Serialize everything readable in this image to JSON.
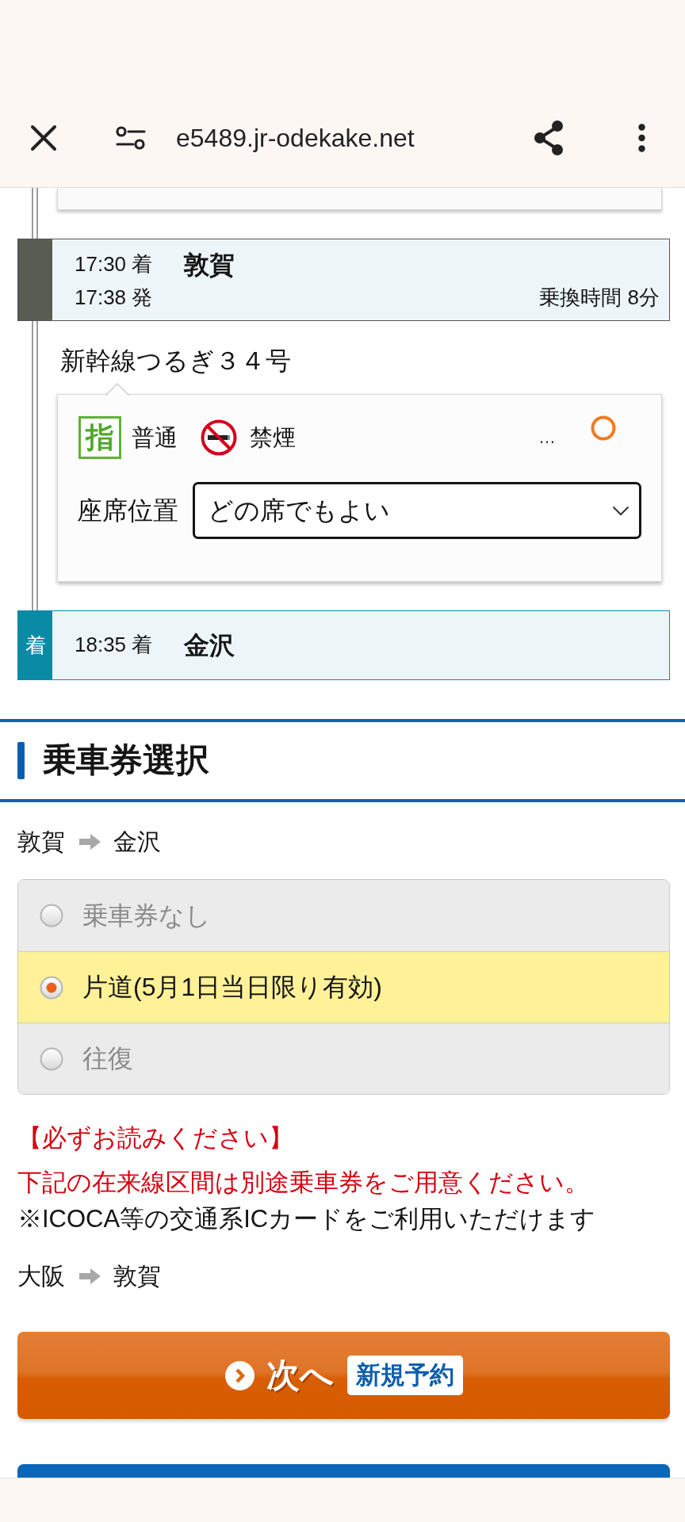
{
  "browser": {
    "url": "e5489.jr-odekake.net"
  },
  "itinerary": [
    {
      "kind": "transfer",
      "arrival": "17:30 着",
      "station": "敦賀",
      "departure": "17:38 発",
      "transfer": "乗換時間 8分"
    },
    {
      "kind": "train",
      "name": "新幹線つるぎ３４号",
      "seat_mark": "指",
      "seat_class": "普通",
      "smoking": "禁煙",
      "more": "…",
      "seat_position": {
        "label": "座席位置",
        "value": "どの席でもよい"
      }
    },
    {
      "kind": "arrival",
      "marker": "着",
      "arrival": "18:35 着",
      "station": "金沢"
    }
  ],
  "ticket_section": {
    "title": "乗車券選択",
    "route": {
      "from": "敦賀",
      "to": "金沢"
    },
    "options": [
      {
        "label": "乗車券なし",
        "selected": false
      },
      {
        "label": "片道(5月1日当日限り有効)",
        "selected": true
      },
      {
        "label": "往復",
        "selected": false
      }
    ],
    "notices": [
      {
        "kind": "warning",
        "text": "【必ずお読みください】"
      },
      {
        "kind": "warning",
        "text": "下記の在来線区間は別途乗車券をご用意ください。"
      },
      {
        "kind": "note",
        "text": "※ICOCA等の交通系ICカードをご利用いただけます"
      }
    ],
    "local_route": {
      "from": "大阪",
      "to": "敦賀"
    }
  },
  "next_button": {
    "label": "次へ",
    "badge": "新規予約"
  }
}
